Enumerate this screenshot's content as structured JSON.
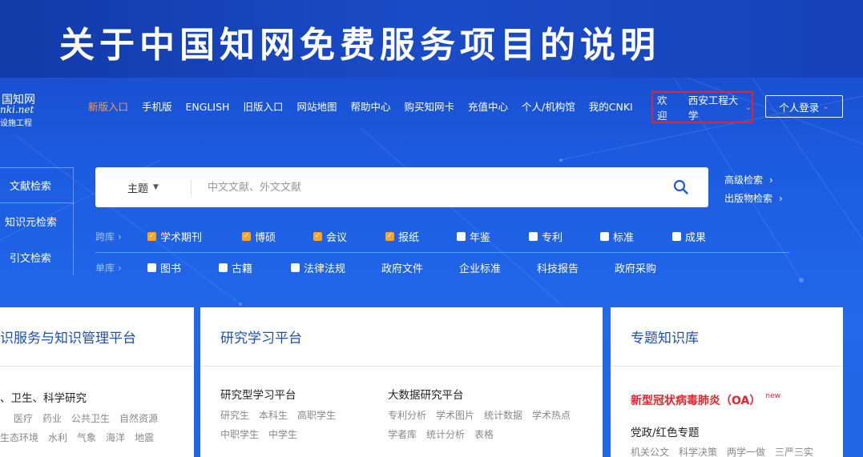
{
  "banner": {
    "title": "关于中国知网免费服务项目的说明"
  },
  "logo": {
    "line1": "国知网",
    "line2": "nki.net",
    "line3": "设施工程"
  },
  "nav": {
    "items": [
      "新版入口",
      "手机版",
      "ENGLISH",
      "旧版入口",
      "网站地图",
      "帮助中心",
      "购买知网卡",
      "充值中心",
      "个人/机构馆",
      "我的CNKI"
    ]
  },
  "user": {
    "welcome": "欢迎",
    "institution": "西安工程大学",
    "login_label": "个人登录"
  },
  "side_tabs": [
    "文献检索",
    "知识元检索",
    "引文检索"
  ],
  "search": {
    "field": "主题",
    "placeholder": "中文文献、外文文献"
  },
  "adv_links": {
    "advanced": "高级检索",
    "publication": "出版物检索"
  },
  "db_rows": {
    "cross_label": "跨库",
    "cross_items": [
      {
        "label": "学术期刊",
        "checked": true
      },
      {
        "label": "博硕",
        "checked": true
      },
      {
        "label": "会议",
        "checked": true
      },
      {
        "label": "报纸",
        "checked": true
      },
      {
        "label": "年鉴",
        "checked": false
      },
      {
        "label": "专利",
        "checked": false
      },
      {
        "label": "标准",
        "checked": false
      },
      {
        "label": "成果",
        "checked": false
      }
    ],
    "single_label": "单库",
    "single_checkbox_items": [
      "图书",
      "古籍",
      "法律法规"
    ],
    "single_plain_items": [
      "政府文件",
      "企业标准",
      "科技报告",
      "政府采购"
    ]
  },
  "cards": {
    "card1": {
      "title": "识服务与知识管理平台",
      "section_title": "、卫生、科学研究",
      "tags_row1": [
        "医疗",
        "药业",
        "公共卫生",
        "自然资源"
      ],
      "tags_row2": [
        "生态环境",
        "水利",
        "气象",
        "海洋",
        "地震"
      ]
    },
    "card2": {
      "title": "研究学习平台",
      "left_title": "研究型学习平台",
      "left_tags_row1": [
        "研究生",
        "本科生",
        "高职学生"
      ],
      "left_tags_row2": [
        "中职学生",
        "中学生"
      ],
      "right_title": "大数据研究平台",
      "right_tags_row1": [
        "专利分析",
        "学术图片",
        "统计数据",
        "学术热点"
      ],
      "right_tags_row2": [
        "学者库",
        "统计分析",
        "表格"
      ]
    },
    "card3": {
      "title": "专题知识库",
      "covid_title": "新型冠状病毒肺炎（OA）",
      "new_badge": "new",
      "party_title": "党政/红色专题",
      "tags_row1": [
        "机关公文",
        "科学决策",
        "两学一做",
        "三严三实"
      ]
    }
  }
}
